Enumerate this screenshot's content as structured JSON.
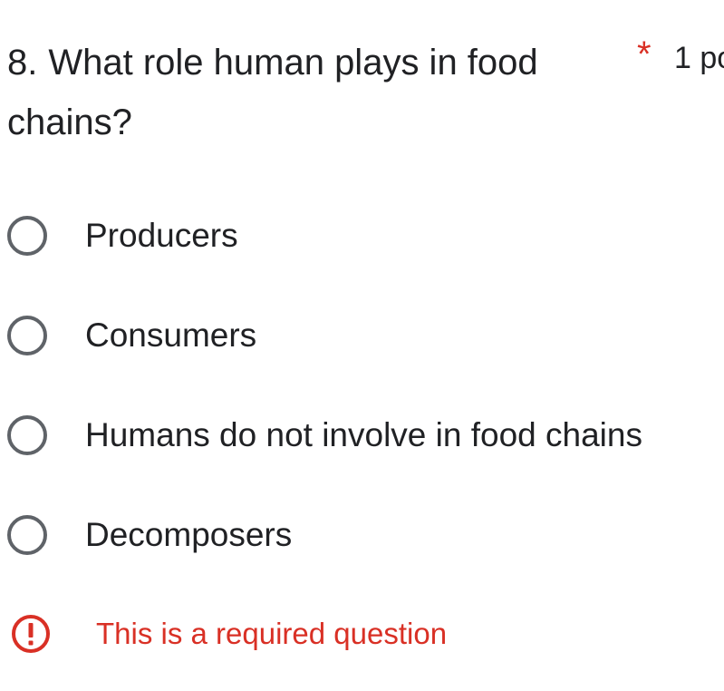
{
  "question": {
    "number": "8.",
    "text": "What role human plays in food chains?",
    "required_marker": "*",
    "points": "1 po"
  },
  "options": [
    {
      "label": "Producers",
      "selected": false
    },
    {
      "label": "Consumers",
      "selected": false
    },
    {
      "label": "Humans do not involve in food chains",
      "selected": false
    },
    {
      "label": "Decomposers",
      "selected": false
    }
  ],
  "validation": {
    "icon": "error-icon",
    "message": "This is a required question"
  },
  "colors": {
    "error": "#d93025",
    "radio_border": "#5f6368",
    "text": "#202124"
  }
}
